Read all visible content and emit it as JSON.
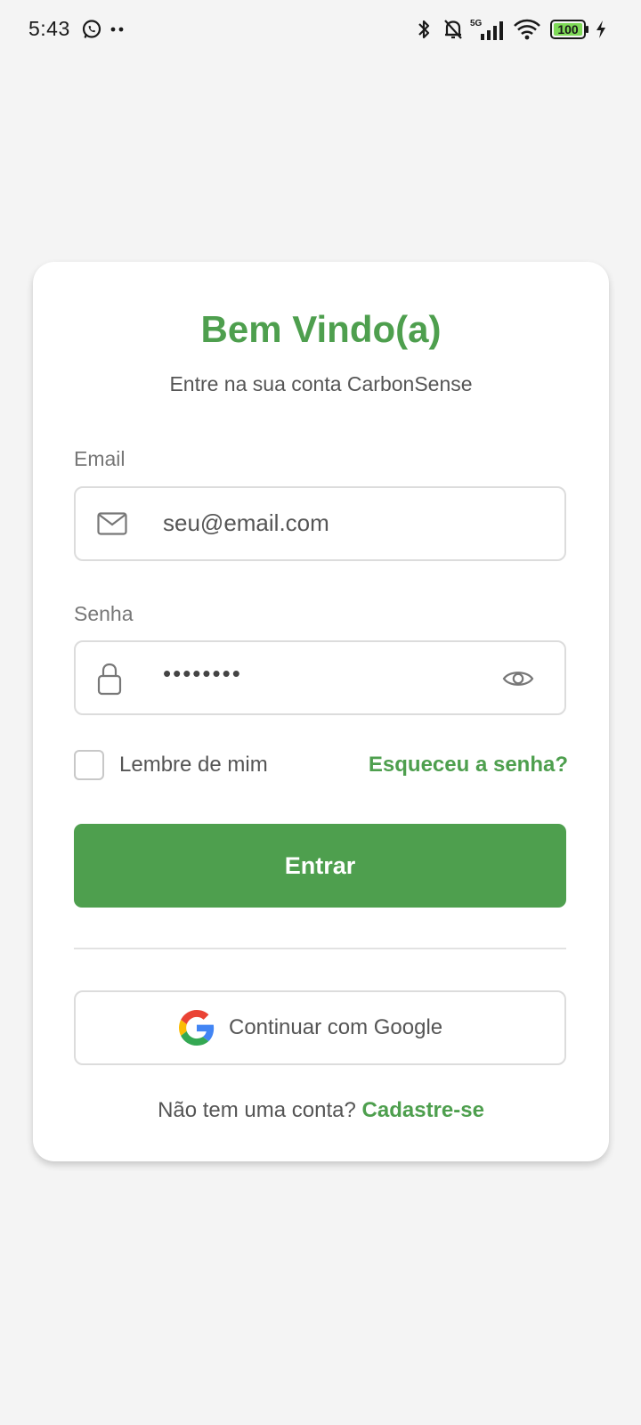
{
  "status_bar": {
    "time": "5:43",
    "network_type": "5G",
    "battery_level": "100"
  },
  "login": {
    "title": "Bem Vindo(a)",
    "subtitle": "Entre na sua conta CarbonSense",
    "email_label": "Email",
    "email_placeholder": "seu@email.com",
    "password_label": "Senha",
    "password_value": "••••••••",
    "remember_me_label": "Lembre de mim",
    "remember_me_checked": false,
    "forgot_password_label": "Esqueceu a senha?",
    "submit_label": "Entrar",
    "google_button_label": "Continuar com Google",
    "signup_prompt": "Não tem uma conta?",
    "signup_link_label": "Cadastre-se"
  },
  "colors": {
    "brand_green": "#4e9f4e",
    "background": "#f4f4f4",
    "card": "#ffffff"
  },
  "icons": {
    "email_field": "mail-icon",
    "password_field": "lock-icon",
    "password_toggle": "eye-icon",
    "google": "google-icon"
  }
}
